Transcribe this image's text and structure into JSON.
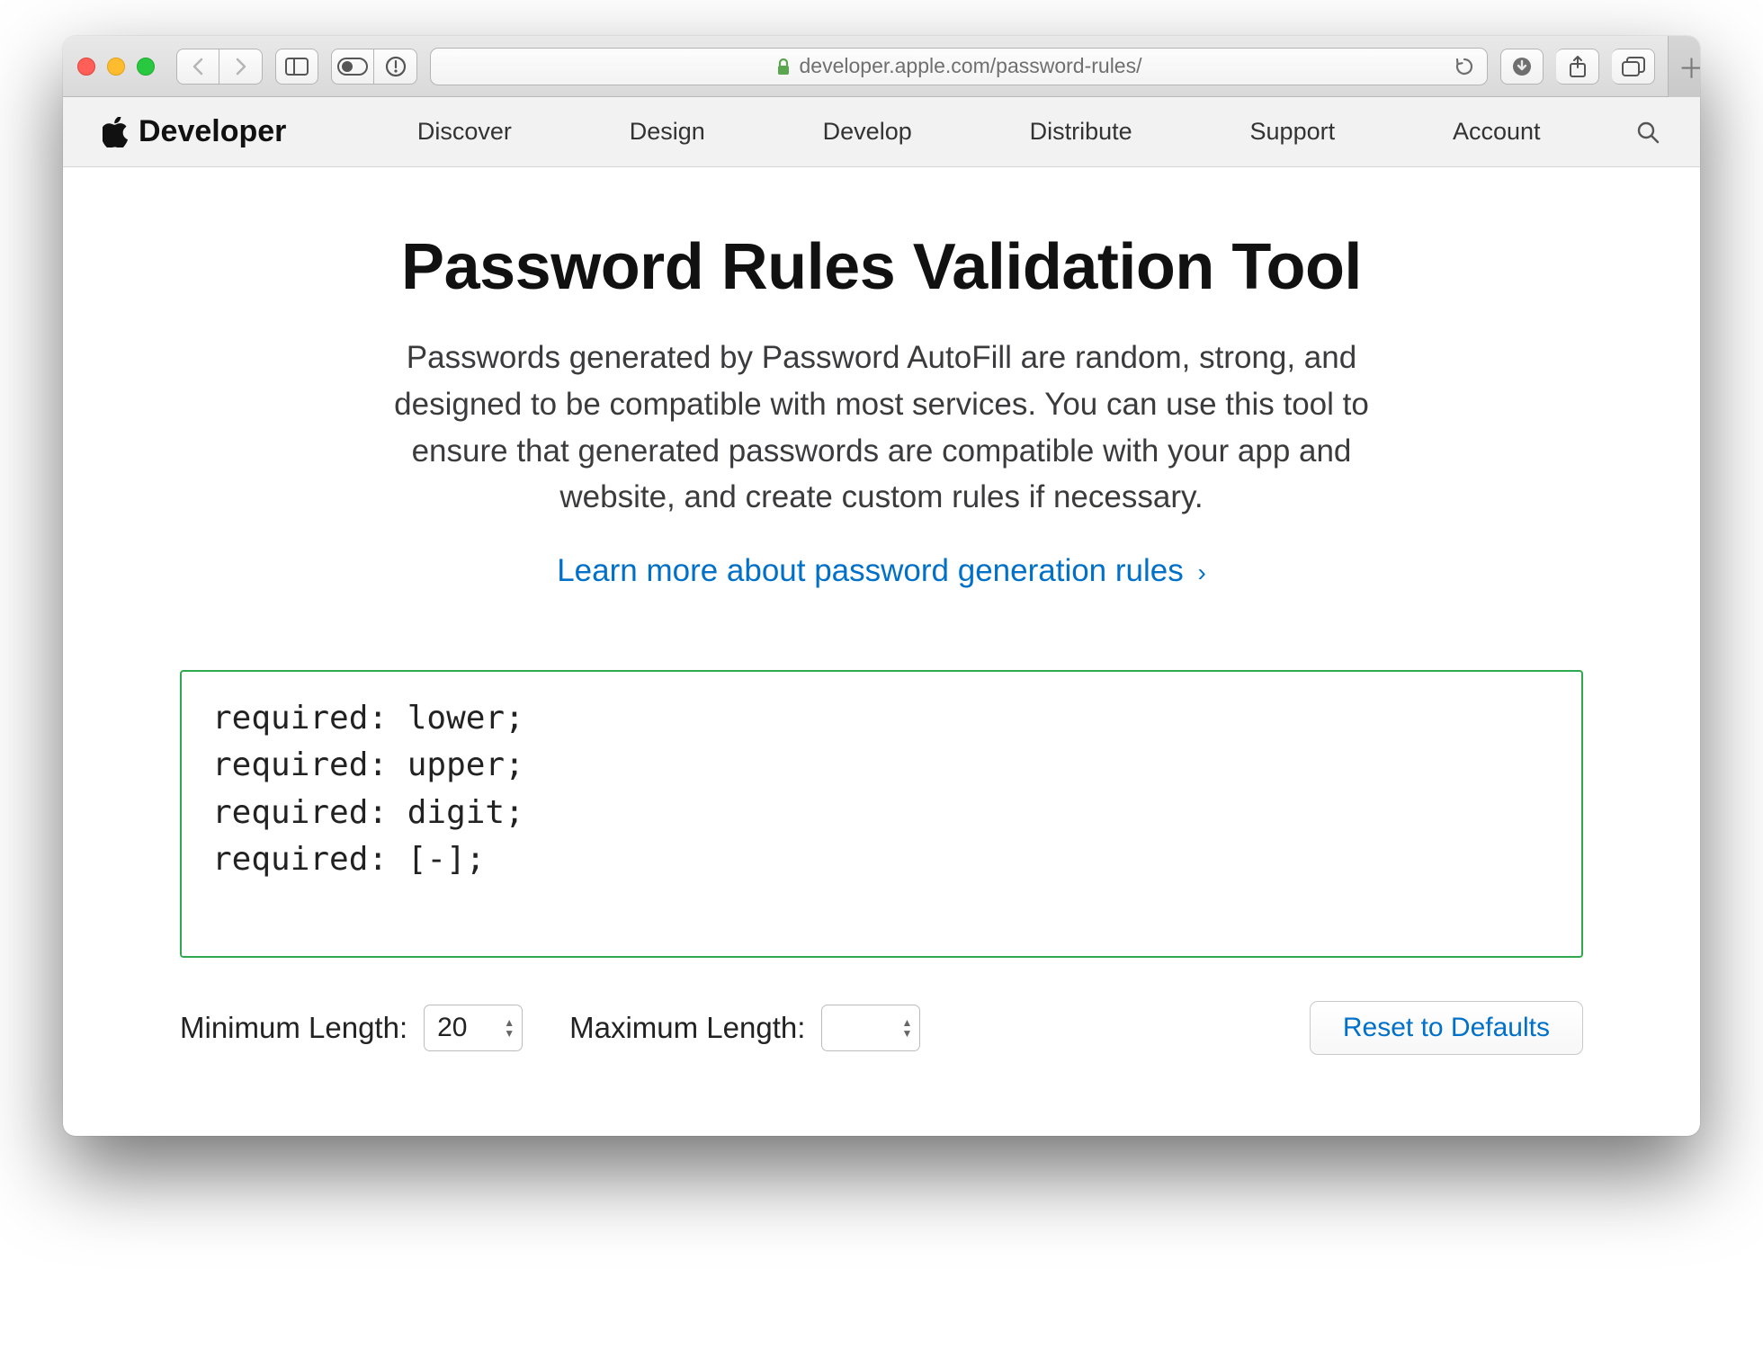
{
  "browser": {
    "url_display": "developer.apple.com/password-rules/"
  },
  "devnav": {
    "brand": "Developer",
    "items": [
      "Discover",
      "Design",
      "Develop",
      "Distribute",
      "Support",
      "Account"
    ]
  },
  "page": {
    "title": "Password Rules Validation Tool",
    "intro": "Passwords generated by Password AutoFill are random, strong, and designed to be compatible with most services. You can use this tool to ensure that generated passwords are compatible with your app and website, and create custom rules if necessary.",
    "learn_more": "Learn more about password generation rules",
    "rules_text": "required: lower;\nrequired: upper;\nrequired: digit;\nrequired: [-];",
    "min_label": "Minimum Length:",
    "max_label": "Maximum Length:",
    "min_value": "20",
    "max_value": "",
    "reset_label": "Reset to Defaults"
  }
}
